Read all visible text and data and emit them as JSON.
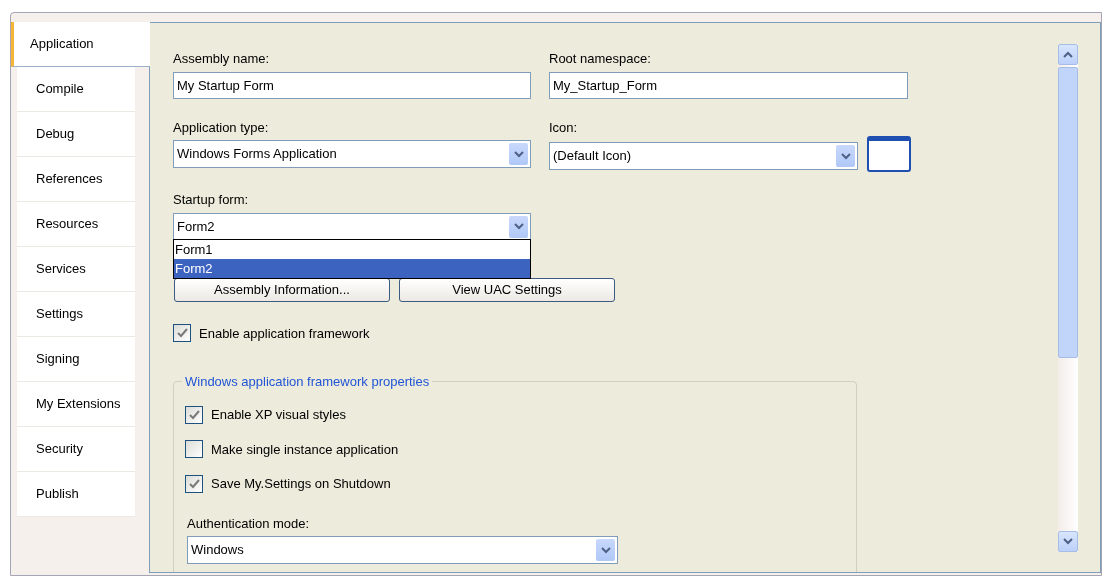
{
  "tabs": [
    {
      "label": "Application",
      "selected": true
    },
    {
      "label": "Compile",
      "selected": false
    },
    {
      "label": "Debug",
      "selected": false
    },
    {
      "label": "References",
      "selected": false
    },
    {
      "label": "Resources",
      "selected": false
    },
    {
      "label": "Services",
      "selected": false
    },
    {
      "label": "Settings",
      "selected": false
    },
    {
      "label": "Signing",
      "selected": false
    },
    {
      "label": "My Extensions",
      "selected": false
    },
    {
      "label": "Security",
      "selected": false
    },
    {
      "label": "Publish",
      "selected": false
    }
  ],
  "assembly_name": {
    "label": "Assembly name:",
    "value": "My Startup Form"
  },
  "root_namespace": {
    "label": "Root namespace:",
    "value": "My_Startup_Form"
  },
  "application_type": {
    "label": "Application type:",
    "value": "Windows Forms Application"
  },
  "icon": {
    "label": "Icon:",
    "value": "(Default Icon)"
  },
  "startup_form": {
    "label": "Startup form:",
    "value": "Form2",
    "expanded": true,
    "options": [
      {
        "label": "Form1",
        "selected": false
      },
      {
        "label": "Form2",
        "selected": true
      }
    ]
  },
  "buttons": [
    "Assembly Information...",
    "View UAC Settings"
  ],
  "enable_framework": {
    "label": "Enable application framework",
    "checked": true
  },
  "framework_group": {
    "title": "Windows application framework properties",
    "options": [
      {
        "label": "Enable XP visual styles",
        "checked": true
      },
      {
        "label": "Make single instance application",
        "checked": false
      },
      {
        "label": "Save My.Settings on Shutdown",
        "checked": true
      }
    ],
    "authentication_mode": {
      "label": "Authentication mode:",
      "value": "Windows"
    }
  }
}
